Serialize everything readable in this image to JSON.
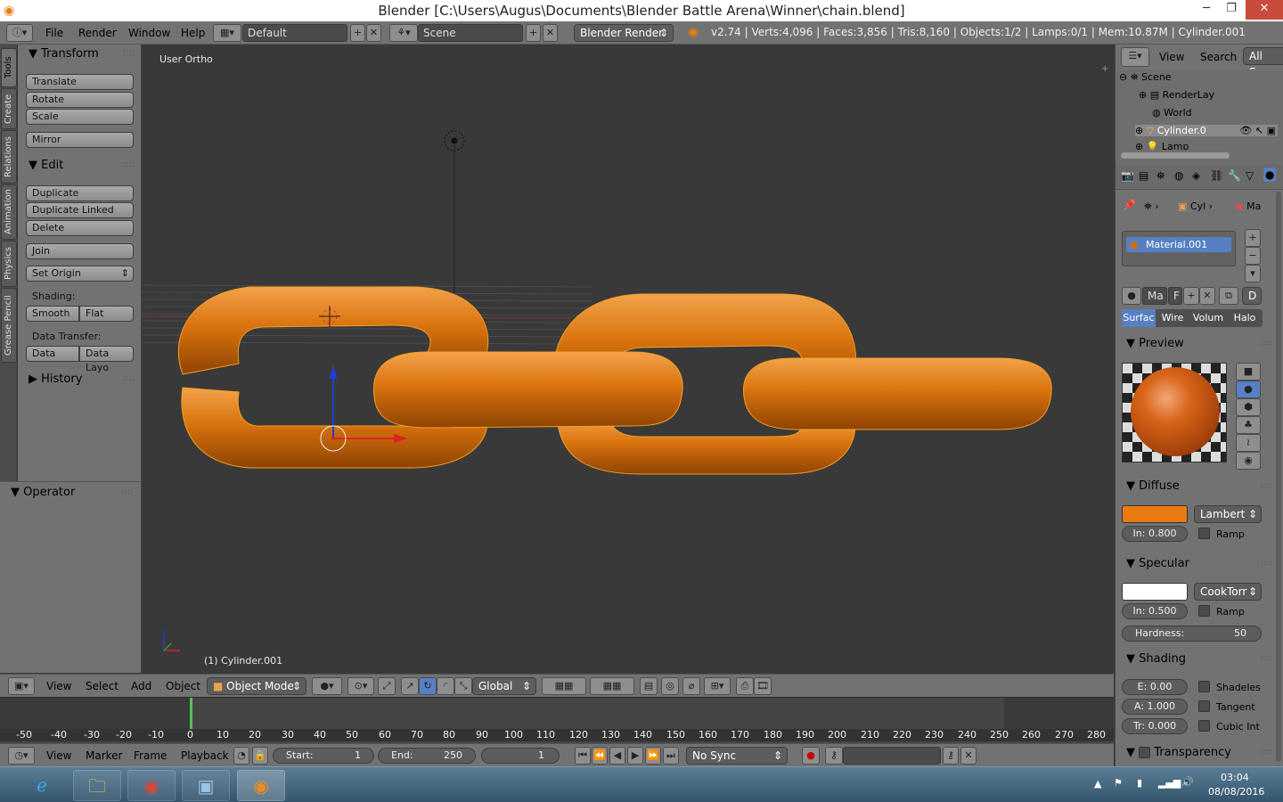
{
  "window": {
    "title": "Blender [C:\\Users\\Augus\\Documents\\Blender Battle Arena\\Winner\\chain.blend]",
    "minimize": "─",
    "maximize": "❐",
    "close": "✕"
  },
  "topbar": {
    "menus": [
      "File",
      "Render",
      "Window",
      "Help"
    ],
    "layout": "Default",
    "scene": "Scene",
    "engine": "Blender Render",
    "stats": "v2.74 | Verts:4,096 | Faces:3,856 | Tris:8,160 | Objects:1/2 | Lamps:0/1 | Mem:10.87M | Cylinder.001"
  },
  "left_tabs": [
    "Tools",
    "Create",
    "Relations",
    "Animation",
    "Physics",
    "Grease Pencil"
  ],
  "tools": {
    "transform_title": "Transform",
    "transform_buttons": [
      "Translate",
      "Rotate",
      "Scale"
    ],
    "mirror": "Mirror",
    "edit_title": "Edit",
    "edit_buttons": [
      "Duplicate",
      "Duplicate Linked",
      "Delete"
    ],
    "join": "Join",
    "set_origin": "Set Origin",
    "shading_label": "Shading:",
    "smooth": "Smooth",
    "flat": "Flat",
    "data_transfer_label": "Data Transfer:",
    "data": "Data",
    "data_layo": "Data Layo",
    "history_title": "History"
  },
  "operator": {
    "title": "Operator"
  },
  "viewport": {
    "view_name": "User Ortho",
    "object_label": "(1) Cylinder.001"
  },
  "viewport_header": {
    "menus": [
      "View",
      "Select",
      "Add",
      "Object"
    ],
    "mode": "Object Mode",
    "orientation": "Global"
  },
  "timeline": {
    "ruler": [
      "-50",
      "-40",
      "-30",
      "-20",
      "-10",
      "0",
      "10",
      "20",
      "30",
      "40",
      "50",
      "60",
      "70",
      "80",
      "90",
      "100",
      "110",
      "120",
      "130",
      "140",
      "150",
      "160",
      "170",
      "180",
      "190",
      "200",
      "210",
      "220",
      "230",
      "240",
      "250",
      "260",
      "270",
      "280"
    ],
    "menus": [
      "View",
      "Marker",
      "Frame",
      "Playback"
    ],
    "start_label": "Start:",
    "start": "1",
    "end_label": "End:",
    "end": "250",
    "current": "1",
    "sync": "No Sync"
  },
  "outliner": {
    "menus": [
      "View",
      "Search"
    ],
    "filter": "All Scen",
    "items": [
      "Scene",
      "RenderLay",
      "World",
      "Cylinder.0",
      "Lamp"
    ]
  },
  "properties": {
    "breadcrumb": [
      "Cyl",
      "Ma"
    ],
    "material_name": "Material.001",
    "ma_field": "Ma",
    "f_field": "F",
    "d_field": "D",
    "tabs": [
      "Surfac",
      "Wire",
      "Volum",
      "Halo"
    ],
    "preview_title": "Preview",
    "diffuse_title": "Diffuse",
    "diffuse_color": "#e97a12",
    "diffuse_shader": "Lambert",
    "diffuse_intensity": "In: 0.800",
    "ramp": "Ramp",
    "specular_title": "Specular",
    "specular_color": "#ffffff",
    "specular_shader": "CookTorr",
    "specular_intensity": "In: 0.500",
    "hardness_label": "Hardness:",
    "hardness": "50",
    "shading_title": "Shading",
    "emit": "E:  0.00",
    "ambient": "A: 1.000",
    "translucency": "Tr: 0.000",
    "shadeless": "Shadeles",
    "tangent": "Tangent",
    "cubic": "Cubic Int",
    "transparency_title": "Transparency"
  },
  "taskbar": {
    "time": "03:04",
    "date": "08/08/2016"
  },
  "colors": {
    "chain": "#d8730f",
    "selection": "#f5a020",
    "ui_panel": "#727272",
    "viewport": "#393939",
    "active_tab": "#5680c2"
  }
}
